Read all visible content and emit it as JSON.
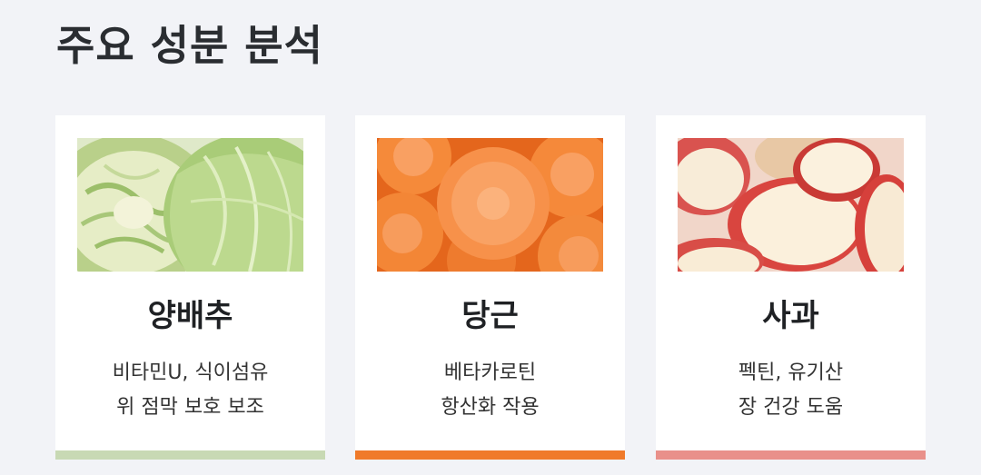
{
  "title": "주요 성분 분석",
  "cards": [
    {
      "name": "양배추",
      "desc_line1": "비타민U, 식이섬유",
      "desc_line2": "위 점막 보호 보조",
      "accent_color": "#c8d9b4"
    },
    {
      "name": "당근",
      "desc_line1": "베타카로틴",
      "desc_line2": "항산화 작용",
      "accent_color": "#f07a2a"
    },
    {
      "name": "사과",
      "desc_line1": "펙틴, 유기산",
      "desc_line2": "장 건강 도움",
      "accent_color": "#e9908a"
    }
  ]
}
